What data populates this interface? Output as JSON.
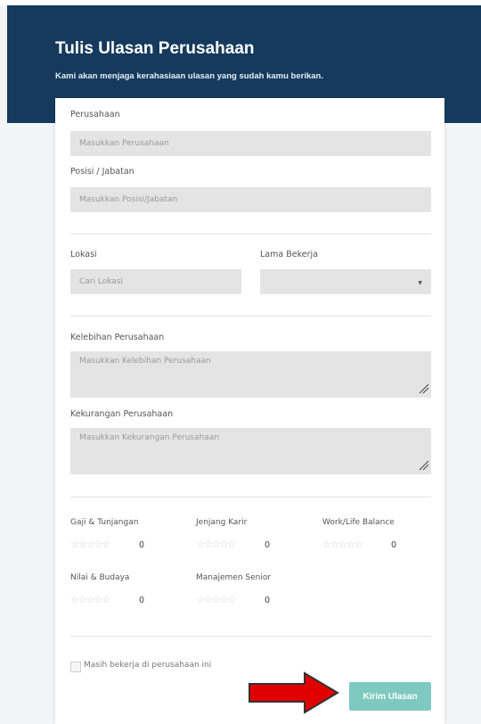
{
  "header": {
    "title": "Tulis Ulasan Perusahaan",
    "subtitle": "Kami akan menjaga kerahasiaan ulasan yang sudah kamu berikan."
  },
  "form": {
    "company": {
      "label": "Perusahaan",
      "placeholder": "Masukkan Perusahaan",
      "value": ""
    },
    "position": {
      "label": "Posisi / Jabatan",
      "placeholder": "Masukkan Posisi/Jabatan",
      "value": ""
    },
    "location": {
      "label": "Lokasi",
      "placeholder": "Cari Lokasi",
      "value": ""
    },
    "duration": {
      "label": "Lama Bekerja",
      "value": ""
    },
    "strengths": {
      "label": "Kelebihan Perusahaan",
      "placeholder": "Masukkan Kelebihan Perusahaan",
      "value": ""
    },
    "weaknesses": {
      "label": "Kekurangan Perusahaan",
      "placeholder": "Masukkan Kekurangan Perusahaan",
      "value": ""
    }
  },
  "ratings": [
    {
      "label": "Gaji & Tunjangan",
      "stars": "☆☆☆☆☆",
      "value": "0"
    },
    {
      "label": "Jenjang Karir",
      "stars": "☆☆☆☆☆",
      "value": "0"
    },
    {
      "label": "Work/Life Balance",
      "stars": "☆☆☆☆☆",
      "value": "0"
    },
    {
      "label": "Nilai & Budaya",
      "stars": "☆☆☆☆☆",
      "value": "0"
    },
    {
      "label": "Manajemen Senior",
      "stars": "☆☆☆☆☆",
      "value": "0"
    }
  ],
  "still_working": {
    "label": "Masih bekerja di perusahaan ini",
    "checked": false
  },
  "submit_label": "Kirim Ulasan",
  "colors": {
    "banner": "#163a5d",
    "submit": "#7ec9c0",
    "annotation_arrow": "#e00000"
  }
}
